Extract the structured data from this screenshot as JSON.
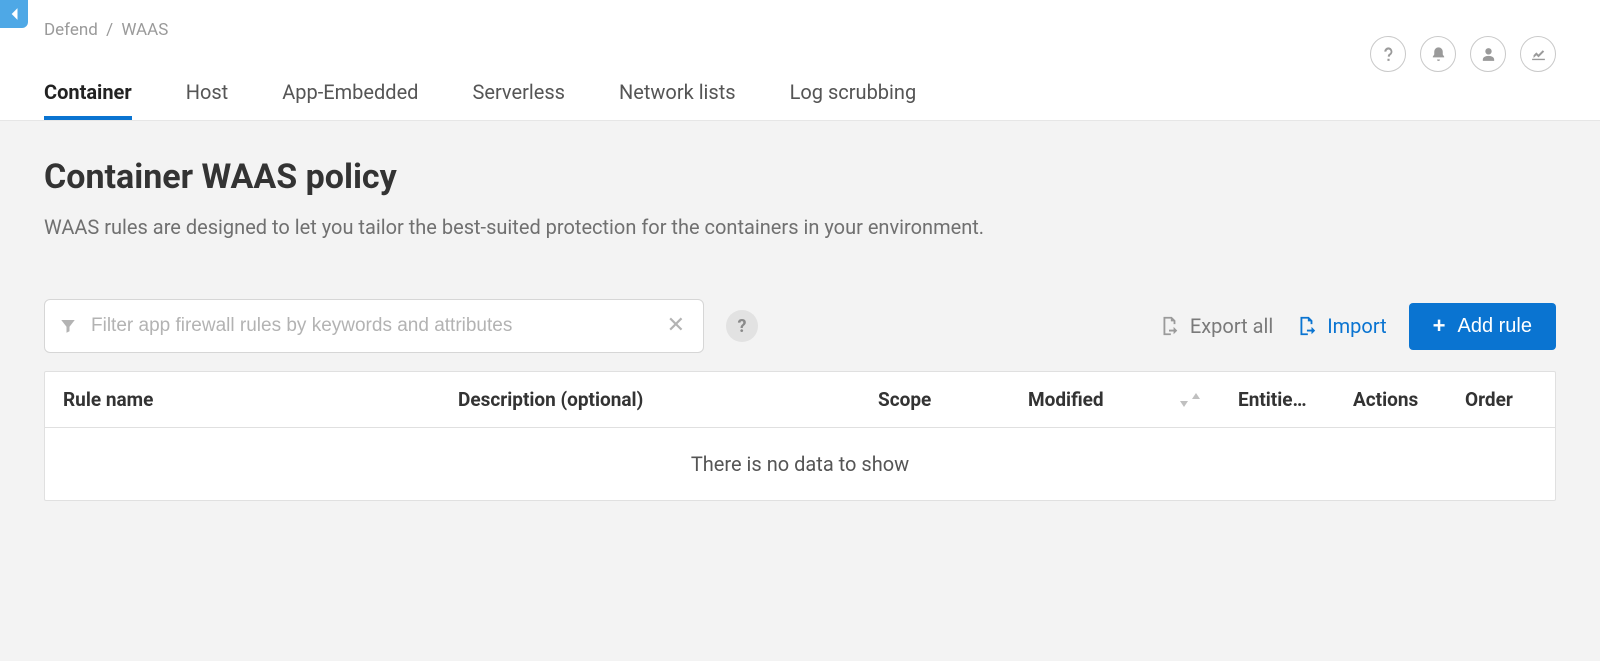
{
  "breadcrumb": {
    "root": "Defend",
    "current": "WAAS",
    "sep": "/"
  },
  "tabs": [
    {
      "label": "Container",
      "active": true
    },
    {
      "label": "Host",
      "active": false
    },
    {
      "label": "App-Embedded",
      "active": false
    },
    {
      "label": "Serverless",
      "active": false
    },
    {
      "label": "Network lists",
      "active": false
    },
    {
      "label": "Log scrubbing",
      "active": false
    }
  ],
  "page": {
    "title": "Container WAAS policy",
    "description": "WAAS rules are designed to let you tailor the best-suited protection for the containers in your environment."
  },
  "toolbar": {
    "filter_placeholder": "Filter app firewall rules by keywords and attributes",
    "export_label": "Export all",
    "import_label": "Import",
    "add_label": "Add rule"
  },
  "table": {
    "columns": {
      "rule_name": "Rule name",
      "description": "Description (optional)",
      "scope": "Scope",
      "modified": "Modified",
      "entities": "Entitie…",
      "actions": "Actions",
      "order": "Order"
    },
    "empty": "There is no data to show",
    "rows": []
  }
}
